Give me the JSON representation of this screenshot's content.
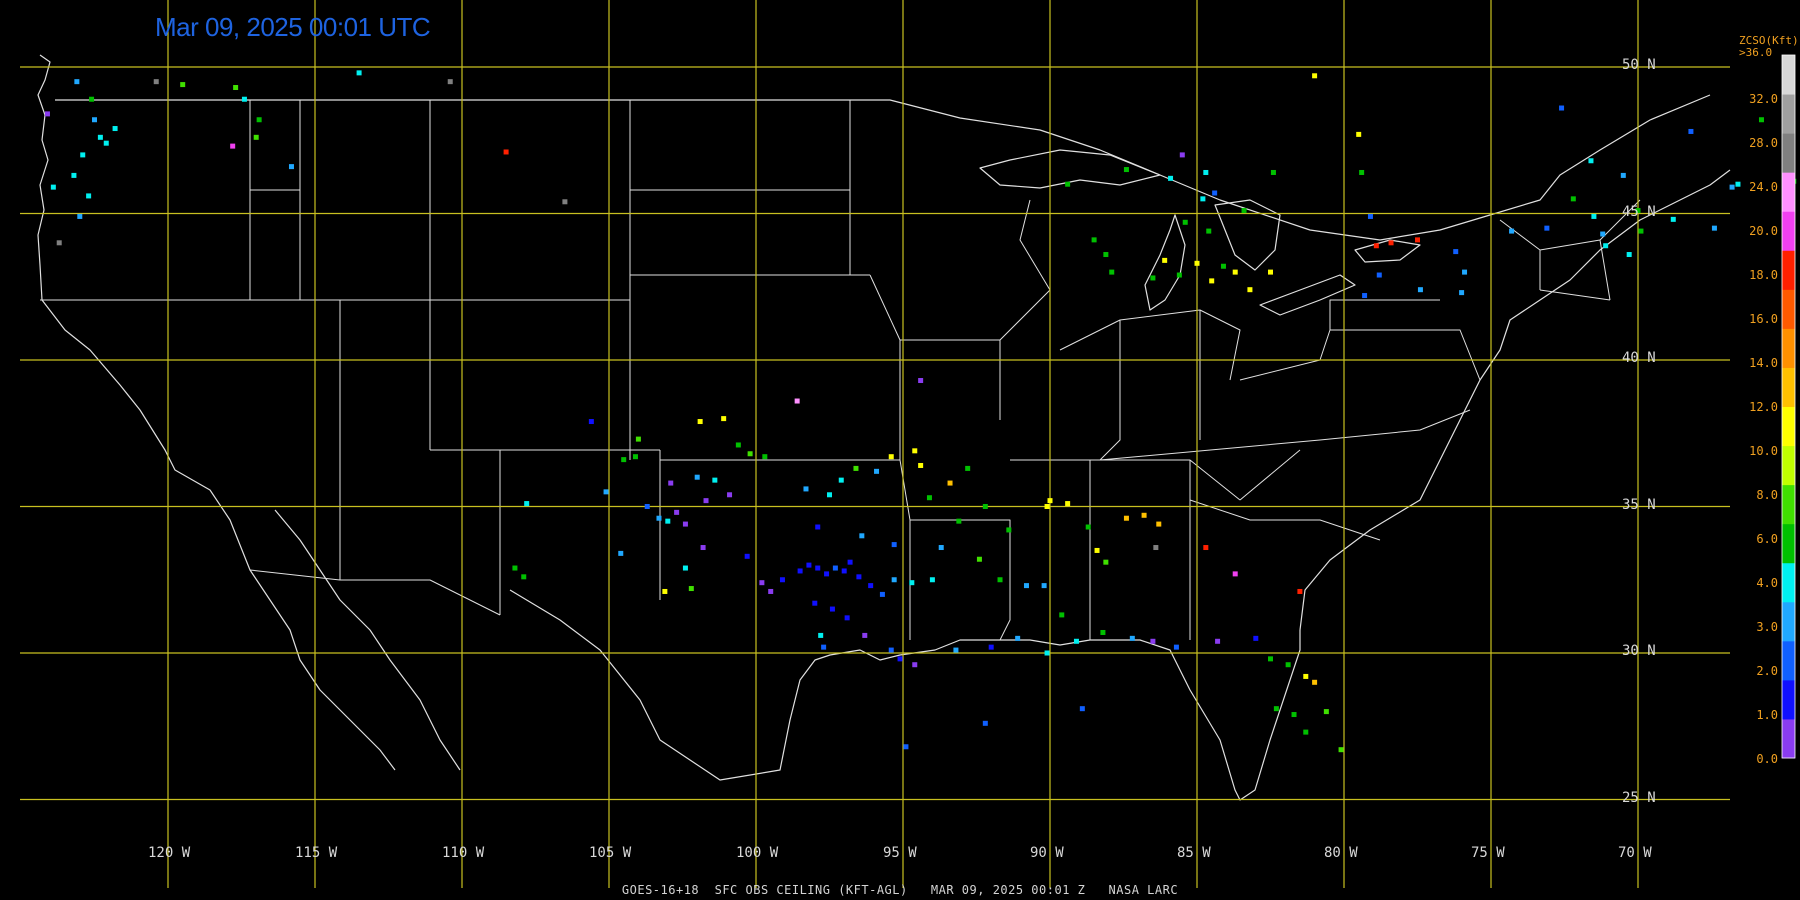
{
  "title": {
    "timestamp": "Mar 09, 2025 00:01 UTC"
  },
  "footer": "GOES-16+18  SFC OBS CEILING (KFT-AGL)   MAR 09, 2025 00:01 Z   NASA LARC",
  "grid": {
    "latitudes": [
      {
        "value": 50,
        "label": "50 N"
      },
      {
        "value": 45,
        "label": "45 N"
      },
      {
        "value": 40,
        "label": "40 N"
      },
      {
        "value": 35,
        "label": "35 N"
      },
      {
        "value": 30,
        "label": "30 N"
      },
      {
        "value": 25,
        "label": "25 N"
      }
    ],
    "longitudes": [
      {
        "value": -120,
        "label": "120 W"
      },
      {
        "value": -115,
        "label": "115 W"
      },
      {
        "value": -110,
        "label": "110 W"
      },
      {
        "value": -105,
        "label": "105 W"
      },
      {
        "value": -100,
        "label": "100 W"
      },
      {
        "value": -95,
        "label": "95 W"
      },
      {
        "value": -90,
        "label": "90 W"
      },
      {
        "value": -85,
        "label": "85 W"
      },
      {
        "value": -80,
        "label": "80 W"
      },
      {
        "value": -75,
        "label": "75 W"
      },
      {
        "value": -70,
        "label": "70 W"
      }
    ]
  },
  "legend": {
    "title_line1": "ZCSO(Kft)",
    "title_line2": ">36.0",
    "ticks": [
      "32.0",
      "28.0",
      "24.0",
      "20.0",
      "18.0",
      "16.0",
      "14.0",
      "12.0",
      "10.0",
      "8.0",
      "6.0",
      "4.0",
      "3.0",
      "2.0",
      "1.0",
      "0.0"
    ],
    "colors": [
      "#8a3cf0",
      "#1010ff",
      "#1060ff",
      "#20a8ff",
      "#00f0f0",
      "#00c000",
      "#40e000",
      "#c0ff00",
      "#ffff00",
      "#ffc000",
      "#ff9000",
      "#ff5a00",
      "#ff2000",
      "#f040f0",
      "#ff90ff",
      "#808080",
      "#a0a0a0",
      "#d8d8d8"
    ]
  },
  "colors": {
    "grid_line": "#c8c020",
    "border": "#e0e0e0",
    "title": "#1e63e0",
    "legend_text": "#f0a020"
  },
  "stations": [
    {
      "lon": -122.6,
      "lat": 48.9,
      "c": "#00c000"
    },
    {
      "lon": -122.3,
      "lat": 47.6,
      "c": "#00f0f0"
    },
    {
      "lon": -122.9,
      "lat": 47.0,
      "c": "#00f0f0"
    },
    {
      "lon": -123.2,
      "lat": 46.3,
      "c": "#00f0f0"
    },
    {
      "lon": -123.9,
      "lat": 45.9,
      "c": "#00f0f0"
    },
    {
      "lon": -122.7,
      "lat": 45.6,
      "c": "#00f0f0"
    },
    {
      "lon": -123.0,
      "lat": 44.9,
      "c": "#20a8ff"
    },
    {
      "lon": -122.5,
      "lat": 48.2,
      "c": "#20a8ff"
    },
    {
      "lon": -122.1,
      "lat": 47.4,
      "c": "#00f0f0"
    },
    {
      "lon": -123.1,
      "lat": 49.5,
      "c": "#20a8ff"
    },
    {
      "lon": -124.1,
      "lat": 48.4,
      "c": "#8a3cf0"
    },
    {
      "lon": -121.8,
      "lat": 47.9,
      "c": "#00f0f0"
    },
    {
      "lon": -120.4,
      "lat": 49.5,
      "c": "#808080"
    },
    {
      "lon": -119.5,
      "lat": 49.4,
      "c": "#40e000"
    },
    {
      "lon": -117.7,
      "lat": 49.3,
      "c": "#40e000"
    },
    {
      "lon": -117.4,
      "lat": 48.9,
      "c": "#00f0f0"
    },
    {
      "lon": -116.9,
      "lat": 48.2,
      "c": "#00c000"
    },
    {
      "lon": -117.8,
      "lat": 47.3,
      "c": "#f040f0"
    },
    {
      "lon": -117.0,
      "lat": 47.6,
      "c": "#40e000"
    },
    {
      "lon": -115.8,
      "lat": 46.6,
      "c": "#20a8ff"
    },
    {
      "lon": -113.5,
      "lat": 49.8,
      "c": "#00f0f0"
    },
    {
      "lon": -110.4,
      "lat": 49.5,
      "c": "#808080"
    },
    {
      "lon": -108.5,
      "lat": 47.1,
      "c": "#ff2000"
    },
    {
      "lon": -106.5,
      "lat": 45.4,
      "c": "#808080"
    },
    {
      "lon": -123.7,
      "lat": 44.0,
      "c": "#808080"
    },
    {
      "lon": -105.6,
      "lat": 37.9,
      "c": "#1010ff"
    },
    {
      "lon": -104.5,
      "lat": 36.6,
      "c": "#00c000"
    },
    {
      "lon": -104.1,
      "lat": 36.7,
      "c": "#00c000"
    },
    {
      "lon": -104.0,
      "lat": 37.3,
      "c": "#40e000"
    },
    {
      "lon": -105.1,
      "lat": 35.5,
      "c": "#20a8ff"
    },
    {
      "lon": -107.8,
      "lat": 35.1,
      "c": "#00f0f0"
    },
    {
      "lon": -108.2,
      "lat": 32.9,
      "c": "#00c000"
    },
    {
      "lon": -107.9,
      "lat": 32.6,
      "c": "#00c000"
    },
    {
      "lon": -104.6,
      "lat": 33.4,
      "c": "#20a8ff"
    },
    {
      "lon": -103.1,
      "lat": 32.1,
      "c": "#ffff00"
    },
    {
      "lon": -102.2,
      "lat": 32.2,
      "c": "#40e000"
    },
    {
      "lon": -102.4,
      "lat": 32.9,
      "c": "#00f0f0"
    },
    {
      "lon": -101.8,
      "lat": 33.6,
      "c": "#8a3cf0"
    },
    {
      "lon": -101.7,
      "lat": 35.2,
      "c": "#8a3cf0"
    },
    {
      "lon": -102.0,
      "lat": 36.0,
      "c": "#20a8ff"
    },
    {
      "lon": -101.4,
      "lat": 35.9,
      "c": "#00f0f0"
    },
    {
      "lon": -100.9,
      "lat": 35.4,
      "c": "#8a3cf0"
    },
    {
      "lon": -100.6,
      "lat": 37.1,
      "c": "#00c000"
    },
    {
      "lon": -101.9,
      "lat": 37.9,
      "c": "#ffff00"
    },
    {
      "lon": -101.1,
      "lat": 38.0,
      "c": "#ffff00"
    },
    {
      "lon": -98.6,
      "lat": 38.6,
      "c": "#ff90ff"
    },
    {
      "lon": -100.2,
      "lat": 36.8,
      "c": "#40e000"
    },
    {
      "lon": -99.7,
      "lat": 36.7,
      "c": "#00c000"
    },
    {
      "lon": -103.0,
      "lat": 34.5,
      "c": "#00f0f0"
    },
    {
      "lon": -102.9,
      "lat": 35.8,
      "c": "#8a3cf0"
    },
    {
      "lon": -103.7,
      "lat": 35.0,
      "c": "#1060ff"
    },
    {
      "lon": -103.3,
      "lat": 34.6,
      "c": "#20a8ff"
    },
    {
      "lon": -102.7,
      "lat": 34.8,
      "c": "#8a3cf0"
    },
    {
      "lon": -102.4,
      "lat": 34.4,
      "c": "#8a3cf0"
    },
    {
      "lon": -100.3,
      "lat": 33.3,
      "c": "#1010ff"
    },
    {
      "lon": -99.8,
      "lat": 32.4,
      "c": "#8a3cf0"
    },
    {
      "lon": -99.5,
      "lat": 32.1,
      "c": "#8a3cf0"
    },
    {
      "lon": -99.1,
      "lat": 32.5,
      "c": "#1010ff"
    },
    {
      "lon": -98.5,
      "lat": 32.8,
      "c": "#1010ff"
    },
    {
      "lon": -98.2,
      "lat": 33.0,
      "c": "#1010ff"
    },
    {
      "lon": -97.9,
      "lat": 32.9,
      "c": "#1010ff"
    },
    {
      "lon": -97.6,
      "lat": 32.7,
      "c": "#1010ff"
    },
    {
      "lon": -97.3,
      "lat": 32.9,
      "c": "#1060ff"
    },
    {
      "lon": -97.0,
      "lat": 32.8,
      "c": "#1010ff"
    },
    {
      "lon": -96.8,
      "lat": 33.1,
      "c": "#1010ff"
    },
    {
      "lon": -96.5,
      "lat": 32.6,
      "c": "#1010ff"
    },
    {
      "lon": -96.1,
      "lat": 32.3,
      "c": "#1010ff"
    },
    {
      "lon": -95.7,
      "lat": 32.0,
      "c": "#1060ff"
    },
    {
      "lon": -95.3,
      "lat": 32.5,
      "c": "#20a8ff"
    },
    {
      "lon": -94.7,
      "lat": 32.4,
      "c": "#00f0f0"
    },
    {
      "lon": -94.0,
      "lat": 32.5,
      "c": "#00f0f0"
    },
    {
      "lon": -98.0,
      "lat": 31.7,
      "c": "#1010ff"
    },
    {
      "lon": -97.4,
      "lat": 31.5,
      "c": "#1010ff"
    },
    {
      "lon": -96.9,
      "lat": 31.2,
      "c": "#1010ff"
    },
    {
      "lon": -97.8,
      "lat": 30.6,
      "c": "#00f0f0"
    },
    {
      "lon": -97.7,
      "lat": 30.2,
      "c": "#1060ff"
    },
    {
      "lon": -96.3,
      "lat": 30.6,
      "c": "#8a3cf0"
    },
    {
      "lon": -95.4,
      "lat": 30.1,
      "c": "#1060ff"
    },
    {
      "lon": -95.1,
      "lat": 29.8,
      "c": "#1010ff"
    },
    {
      "lon": -94.6,
      "lat": 29.6,
      "c": "#8a3cf0"
    },
    {
      "lon": -93.2,
      "lat": 30.1,
      "c": "#20a8ff"
    },
    {
      "lon": -92.0,
      "lat": 30.2,
      "c": "#1010ff"
    },
    {
      "lon": -91.1,
      "lat": 30.5,
      "c": "#20a8ff"
    },
    {
      "lon": -90.1,
      "lat": 30.0,
      "c": "#00f0f0"
    },
    {
      "lon": -89.1,
      "lat": 30.4,
      "c": "#00f0f0"
    },
    {
      "lon": -88.2,
      "lat": 30.7,
      "c": "#00c000"
    },
    {
      "lon": -87.2,
      "lat": 30.5,
      "c": "#20a8ff"
    },
    {
      "lon": -86.5,
      "lat": 30.4,
      "c": "#8a3cf0"
    },
    {
      "lon": -85.7,
      "lat": 30.2,
      "c": "#1060ff"
    },
    {
      "lon": -84.3,
      "lat": 30.4,
      "c": "#8a3cf0"
    },
    {
      "lon": -83.0,
      "lat": 30.5,
      "c": "#1010ff"
    },
    {
      "lon": -98.3,
      "lat": 35.6,
      "c": "#20a8ff"
    },
    {
      "lon": -97.5,
      "lat": 35.4,
      "c": "#00f0f0"
    },
    {
      "lon": -97.1,
      "lat": 35.9,
      "c": "#00f0f0"
    },
    {
      "lon": -96.6,
      "lat": 36.3,
      "c": "#40e000"
    },
    {
      "lon": -95.9,
      "lat": 36.2,
      "c": "#20a8ff"
    },
    {
      "lon": -95.4,
      "lat": 36.7,
      "c": "#ffff00"
    },
    {
      "lon": -94.6,
      "lat": 36.9,
      "c": "#ffff00"
    },
    {
      "lon": -94.4,
      "lat": 36.4,
      "c": "#ffff00"
    },
    {
      "lon": -93.4,
      "lat": 35.8,
      "c": "#ffc000"
    },
    {
      "lon": -92.8,
      "lat": 36.3,
      "c": "#00c000"
    },
    {
      "lon": -92.2,
      "lat": 35.0,
      "c": "#00c000"
    },
    {
      "lon": -91.4,
      "lat": 34.2,
      "c": "#00c000"
    },
    {
      "lon": -93.1,
      "lat": 34.5,
      "c": "#00c000"
    },
    {
      "lon": -94.1,
      "lat": 35.3,
      "c": "#00c000"
    },
    {
      "lon": -97.9,
      "lat": 34.3,
      "c": "#1010ff"
    },
    {
      "lon": -96.4,
      "lat": 34.0,
      "c": "#20a8ff"
    },
    {
      "lon": -95.3,
      "lat": 33.7,
      "c": "#1060ff"
    },
    {
      "lon": -93.7,
      "lat": 33.6,
      "c": "#20a8ff"
    },
    {
      "lon": -92.4,
      "lat": 33.2,
      "c": "#40e000"
    },
    {
      "lon": -91.7,
      "lat": 32.5,
      "c": "#00c000"
    },
    {
      "lon": -90.8,
      "lat": 32.3,
      "c": "#20a8ff"
    },
    {
      "lon": -90.2,
      "lat": 32.3,
      "c": "#20a8ff"
    },
    {
      "lon": -89.6,
      "lat": 31.3,
      "c": "#00c000"
    },
    {
      "lon": -90.1,
      "lat": 35.0,
      "c": "#ffff00"
    },
    {
      "lon": -90.0,
      "lat": 35.2,
      "c": "#ffff00"
    },
    {
      "lon": -89.4,
      "lat": 35.1,
      "c": "#ffff00"
    },
    {
      "lon": -88.7,
      "lat": 34.3,
      "c": "#00c000"
    },
    {
      "lon": -88.4,
      "lat": 33.5,
      "c": "#ffff00"
    },
    {
      "lon": -88.1,
      "lat": 33.1,
      "c": "#40e000"
    },
    {
      "lon": -87.4,
      "lat": 34.6,
      "c": "#ffc000"
    },
    {
      "lon": -86.8,
      "lat": 34.7,
      "c": "#ffc000"
    },
    {
      "lon": -86.3,
      "lat": 34.4,
      "c": "#ffc000"
    },
    {
      "lon": -86.4,
      "lat": 33.6,
      "c": "#808080"
    },
    {
      "lon": -84.7,
      "lat": 33.6,
      "c": "#ff2000"
    },
    {
      "lon": -83.7,
      "lat": 32.7,
      "c": "#f040f0"
    },
    {
      "lon": -81.5,
      "lat": 32.1,
      "c": "#ff2000"
    },
    {
      "lon": -82.5,
      "lat": 29.8,
      "c": "#00c000"
    },
    {
      "lon": -81.9,
      "lat": 29.6,
      "c": "#00c000"
    },
    {
      "lon": -81.3,
      "lat": 29.2,
      "c": "#ffff00"
    },
    {
      "lon": -81.0,
      "lat": 29.0,
      "c": "#ffc000"
    },
    {
      "lon": -82.3,
      "lat": 28.1,
      "c": "#00c000"
    },
    {
      "lon": -81.7,
      "lat": 27.9,
      "c": "#00c000"
    },
    {
      "lon": -80.6,
      "lat": 28.0,
      "c": "#40e000"
    },
    {
      "lon": -81.3,
      "lat": 27.3,
      "c": "#00c000"
    },
    {
      "lon": -80.1,
      "lat": 26.7,
      "c": "#40e000"
    },
    {
      "lon": -88.9,
      "lat": 28.1,
      "c": "#1060ff"
    },
    {
      "lon": -92.2,
      "lat": 27.6,
      "c": "#1060ff"
    },
    {
      "lon": -94.9,
      "lat": 26.8,
      "c": "#1060ff"
    },
    {
      "lon": -94.4,
      "lat": 39.3,
      "c": "#8a3cf0"
    },
    {
      "lon": -88.5,
      "lat": 44.1,
      "c": "#00c000"
    },
    {
      "lon": -88.1,
      "lat": 43.6,
      "c": "#00c000"
    },
    {
      "lon": -87.9,
      "lat": 43.0,
      "c": "#00c000"
    },
    {
      "lon": -86.5,
      "lat": 42.8,
      "c": "#00c000"
    },
    {
      "lon": -86.1,
      "lat": 43.4,
      "c": "#ffff00"
    },
    {
      "lon": -85.6,
      "lat": 42.9,
      "c": "#00c000"
    },
    {
      "lon": -85.0,
      "lat": 43.3,
      "c": "#ffff00"
    },
    {
      "lon": -84.5,
      "lat": 42.7,
      "c": "#ffff00"
    },
    {
      "lon": -84.1,
      "lat": 43.2,
      "c": "#00c000"
    },
    {
      "lon": -83.7,
      "lat": 43.0,
      "c": "#ffff00"
    },
    {
      "lon": -83.2,
      "lat": 42.4,
      "c": "#ffff00"
    },
    {
      "lon": -84.6,
      "lat": 44.4,
      "c": "#00c000"
    },
    {
      "lon": -85.4,
      "lat": 44.7,
      "c": "#00c000"
    },
    {
      "lon": -84.8,
      "lat": 45.5,
      "c": "#00f0f0"
    },
    {
      "lon": -84.4,
      "lat": 45.7,
      "c": "#1060ff"
    },
    {
      "lon": -85.9,
      "lat": 46.2,
      "c": "#00f0f0"
    },
    {
      "lon": -87.4,
      "lat": 46.5,
      "c": "#00c000"
    },
    {
      "lon": -84.7,
      "lat": 46.4,
      "c": "#00f0f0"
    },
    {
      "lon": -82.4,
      "lat": 46.4,
      "c": "#00c000"
    },
    {
      "lon": -85.5,
      "lat": 47.0,
      "c": "#8a3cf0"
    },
    {
      "lon": -83.4,
      "lat": 45.1,
      "c": "#00c000"
    },
    {
      "lon": -82.5,
      "lat": 43.0,
      "c": "#ffff00"
    },
    {
      "lon": -89.4,
      "lat": 46.0,
      "c": "#00c000"
    },
    {
      "lon": -81.0,
      "lat": 49.7,
      "c": "#ffff00"
    },
    {
      "lon": -79.5,
      "lat": 47.7,
      "c": "#ffff00"
    },
    {
      "lon": -79.4,
      "lat": 46.4,
      "c": "#00c000"
    },
    {
      "lon": -79.1,
      "lat": 44.9,
      "c": "#1060ff"
    },
    {
      "lon": -78.9,
      "lat": 43.9,
      "c": "#ff2000"
    },
    {
      "lon": -78.4,
      "lat": 44.0,
      "c": "#ff2000"
    },
    {
      "lon": -77.5,
      "lat": 44.1,
      "c": "#ff2000"
    },
    {
      "lon": -76.2,
      "lat": 43.7,
      "c": "#1060ff"
    },
    {
      "lon": -75.9,
      "lat": 43.0,
      "c": "#20a8ff"
    },
    {
      "lon": -74.3,
      "lat": 44.4,
      "c": "#20a8ff"
    },
    {
      "lon": -73.1,
      "lat": 44.5,
      "c": "#1060ff"
    },
    {
      "lon": -79.3,
      "lat": 42.2,
      "c": "#1060ff"
    },
    {
      "lon": -78.8,
      "lat": 42.9,
      "c": "#1060ff"
    },
    {
      "lon": -77.4,
      "lat": 42.4,
      "c": "#20a8ff"
    },
    {
      "lon": -76.0,
      "lat": 42.3,
      "c": "#20a8ff"
    },
    {
      "lon": -72.6,
      "lat": 48.6,
      "c": "#1060ff"
    },
    {
      "lon": -71.6,
      "lat": 46.8,
      "c": "#00f0f0"
    },
    {
      "lon": -70.5,
      "lat": 46.3,
      "c": "#20a8ff"
    },
    {
      "lon": -68.2,
      "lat": 47.8,
      "c": "#1060ff"
    },
    {
      "lon": -66.6,
      "lat": 46.0,
      "c": "#00f0f0"
    },
    {
      "lon": -68.8,
      "lat": 44.8,
      "c": "#00f0f0"
    },
    {
      "lon": -70.3,
      "lat": 43.6,
      "c": "#00f0f0"
    },
    {
      "lon": -71.2,
      "lat": 44.3,
      "c": "#20a8ff"
    },
    {
      "lon": -71.5,
      "lat": 44.9,
      "c": "#00f0f0"
    },
    {
      "lon": -69.9,
      "lat": 44.4,
      "c": "#00c000"
    },
    {
      "lon": -70.0,
      "lat": 45.1,
      "c": "#00c000"
    },
    {
      "lon": -72.2,
      "lat": 45.5,
      "c": "#00c000"
    },
    {
      "lon": -71.1,
      "lat": 43.9,
      "c": "#00f0f0"
    },
    {
      "lon": -64.7,
      "lat": 46.1,
      "c": "#00c000"
    },
    {
      "lon": -65.8,
      "lat": 48.2,
      "c": "#00c000"
    },
    {
      "lon": -66.8,
      "lat": 45.9,
      "c": "#20a8ff"
    },
    {
      "lon": -67.4,
      "lat": 44.5,
      "c": "#20a8ff"
    }
  ]
}
